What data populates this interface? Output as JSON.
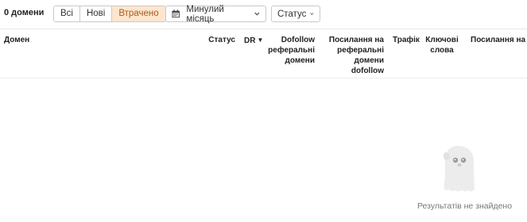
{
  "toolbar": {
    "count_label": "0 домени",
    "filter_tabs": [
      {
        "label": "Всі",
        "active": false
      },
      {
        "label": "Нові",
        "active": false
      },
      {
        "label": "Втрачено",
        "active": true
      }
    ],
    "date_filter": {
      "label": "Минулий місяць",
      "icon": "calendar-icon"
    },
    "status_filter": {
      "label": "Статус"
    }
  },
  "table": {
    "columns": {
      "domain": "Домен",
      "status": "Статус",
      "dr": "DR",
      "dofollow_referring": [
        "Dofollow",
        "реферальні",
        "домени"
      ],
      "links_ref_dofollow": [
        "Посилання на",
        "реферальні",
        "домени",
        "dofollow"
      ],
      "traffic": "Трафік",
      "keywords": [
        "Ключові",
        "слова"
      ],
      "links": "Посилання на"
    },
    "sort_column": "DR",
    "sort_direction": "desc",
    "rows": []
  },
  "empty_state": {
    "message": "Результатів не знайдено",
    "illustration": "ghost-illustration"
  },
  "colors": {
    "active_tab_bg": "#fde6cd",
    "active_tab_text": "#a85a1f",
    "border": "#c9c9c9"
  }
}
